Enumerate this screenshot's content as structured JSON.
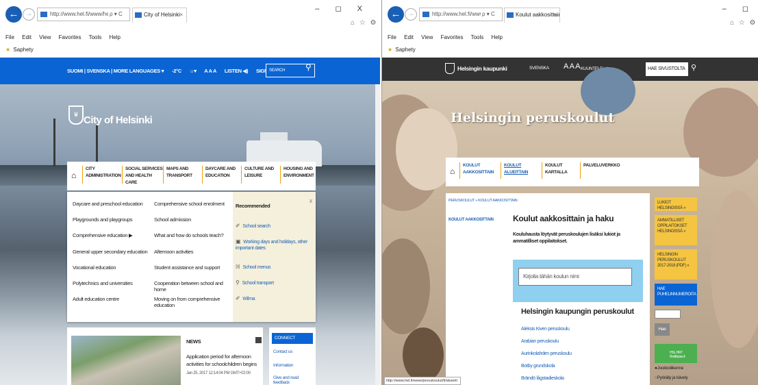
{
  "left": {
    "window_controls": "–  ◻  X",
    "url": "http://www.hel.fi/www/helsinki/en",
    "addr_controls": "ρ ▾ C",
    "tab_title": "City of Helsinki",
    "tab_close": "×",
    "toolbar_icons": "⌂ ☆ ⚙",
    "menu": [
      "File",
      "Edit",
      "View",
      "Favorites",
      "Tools",
      "Help"
    ],
    "favorite": "Saphety",
    "topbar": {
      "language": "SUOMI | SVENSKA | MORE LANGUAGES ▾",
      "temp": "-2°C",
      "weather": "☼▾",
      "text_size": "A A A",
      "listen": "LISTEN ◀)",
      "sign_in": "SIGN IN: E-SERVICES ▾",
      "search_placeholder": "SEARCH",
      "search_icon": "magnifier-icon"
    },
    "site_name": "City of Helsinki",
    "nav": [
      "CITY ADMINISTRATION",
      "SOCIAL SERVICES AND HEALTH CARE",
      "MAPS AND TRANSPORT",
      "DAYCARE AND EDUCATION",
      "CULTURE AND LEISURE",
      "HOUSING AND ENVIRONMENT"
    ],
    "dropdown": {
      "col1": [
        "Daycare and preschool education",
        "Playgrounds and playgroups",
        "Comprehensive education ▶",
        "General upper secondary education",
        "Vocational education",
        "Polytechnics and universities",
        "Adult education centre"
      ],
      "col2": [
        "Comprehensive school enrolment",
        "School admission",
        "What and how do schools teach?",
        "Afternoon activities",
        "Student assistance and support",
        "Cooperation between school and home",
        "Moving on from comprehensive education"
      ],
      "recommended_header": "Recommended",
      "recommended": [
        {
          "label": "School search",
          "icon": "✐"
        },
        {
          "label": "Working days and holidays, other important dates",
          "icon": "▣"
        },
        {
          "label": "School menus",
          "icon": "ℍ"
        },
        {
          "label": "School transport",
          "icon": "⚲"
        },
        {
          "label": "Wilma",
          "icon": "✐"
        }
      ],
      "close": "x"
    },
    "news": {
      "header": "NEWS",
      "title": "Application period for afternoon activities for schoolchildren begins",
      "date": "Jan 25, 2017 12:14:04 PM GMT+02:00"
    },
    "connect": {
      "header": "CONNECT",
      "links": [
        "Contact us",
        "Information",
        "Give and read feedback"
      ]
    }
  },
  "right": {
    "window_controls": "–  ◻",
    "url": "http://www.hel.fi/www/peruskoulut/fi/koulut/",
    "addr_controls": "ρ ▾ C",
    "tab_title": "Koulut aakkosittain ja haku ...",
    "tab_close": "×",
    "toolbar_icons": "⌂ ☆ ⚙",
    "menu": [
      "File",
      "Edit",
      "View",
      "Favorites",
      "Tools",
      "Help"
    ],
    "favorite": "Saphety",
    "topbar": {
      "title": "Helsingin kaupunki",
      "svenska": "SVENSKA",
      "text_size": "A A A",
      "listen": "KUUNTELE ◀)",
      "search_placeholder": "HAE SIVUSTOLTA",
      "search_icon": "magnifier-icon"
    },
    "banner_title": "Helsingin peruskoulut",
    "nav": [
      "KOULUT AAKKOSITTAIN",
      "KOULUT ALUEITTAIN",
      "KOULUT KARTALLA",
      "PALVELUVERKKO"
    ],
    "breadcrumb": "PERUSKOULUT » KOULUT AAKKOSITTAIN",
    "side_link": "KOULUT AAKKOSITTAIN",
    "heading": "Koulut aakkosittain ja haku",
    "intro": "Kouluhausta löytyvät peruskoulujen lisäksi lukiot ja ammatilliset oppilaitokset.",
    "search_placeholder": "Kirjoita tähän koulun nimi",
    "schools_heading": "Helsingin kaupungin peruskoulut",
    "schools": [
      "Aleksis Kiven peruskoulu",
      "Arabian peruskoulu",
      "Aurinkolahden peruskoulu",
      "Botby grundskola",
      "Brändö lågstadieskola"
    ],
    "side_boxes": [
      "LUKIOT HELSINGISSÄ »",
      "AMMATILLISET OPPILAITOKSET HELSINGISSÄ »",
      "HELSINGIN PERUSKOULUT 2017-2018 (PDF) »"
    ],
    "blue_box": "HAE PUHELINNUMEROITA",
    "hae_button": "Hae",
    "hsl_label": "HSL HRT Reittiopas.fi",
    "radios": [
      "●Joukkoliikenne",
      "○Pyöräily ja kävely"
    ],
    "status_url": "http://www.hel.fi/www/peruskoulut/fi/alueet/"
  }
}
